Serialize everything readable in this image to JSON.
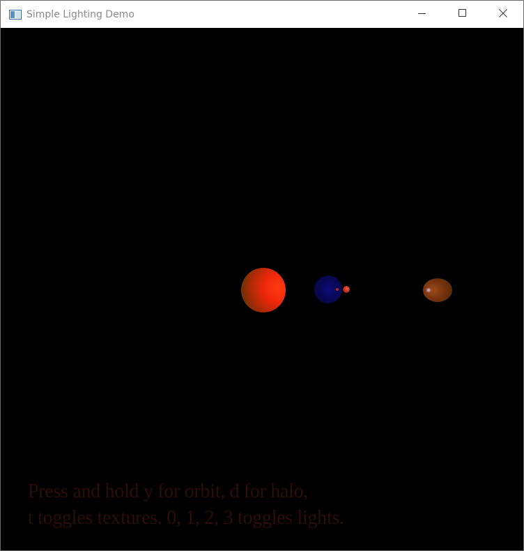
{
  "window": {
    "title": "Simple Lighting Demo",
    "app_icon": "window-app-icon",
    "controls": {
      "minimize_icon": "minimize-icon",
      "maximize_icon": "maximize-icon",
      "close_icon": "close-icon"
    }
  },
  "scene": {
    "background_color": "#000000",
    "objects": [
      {
        "name": "sun",
        "color": "#ff2a0a"
      },
      {
        "name": "blue-planet",
        "color": "#0a0a6e"
      },
      {
        "name": "red-moon",
        "color": "#e0321e"
      },
      {
        "name": "brown-planet",
        "color": "#7a3510"
      }
    ]
  },
  "instructions": {
    "line1": "Press and hold y for orbit, d for halo,",
    "line2": "t toggles textures. 0, 1, 2, 3 toggles lights.",
    "color": "#2a0e07"
  }
}
